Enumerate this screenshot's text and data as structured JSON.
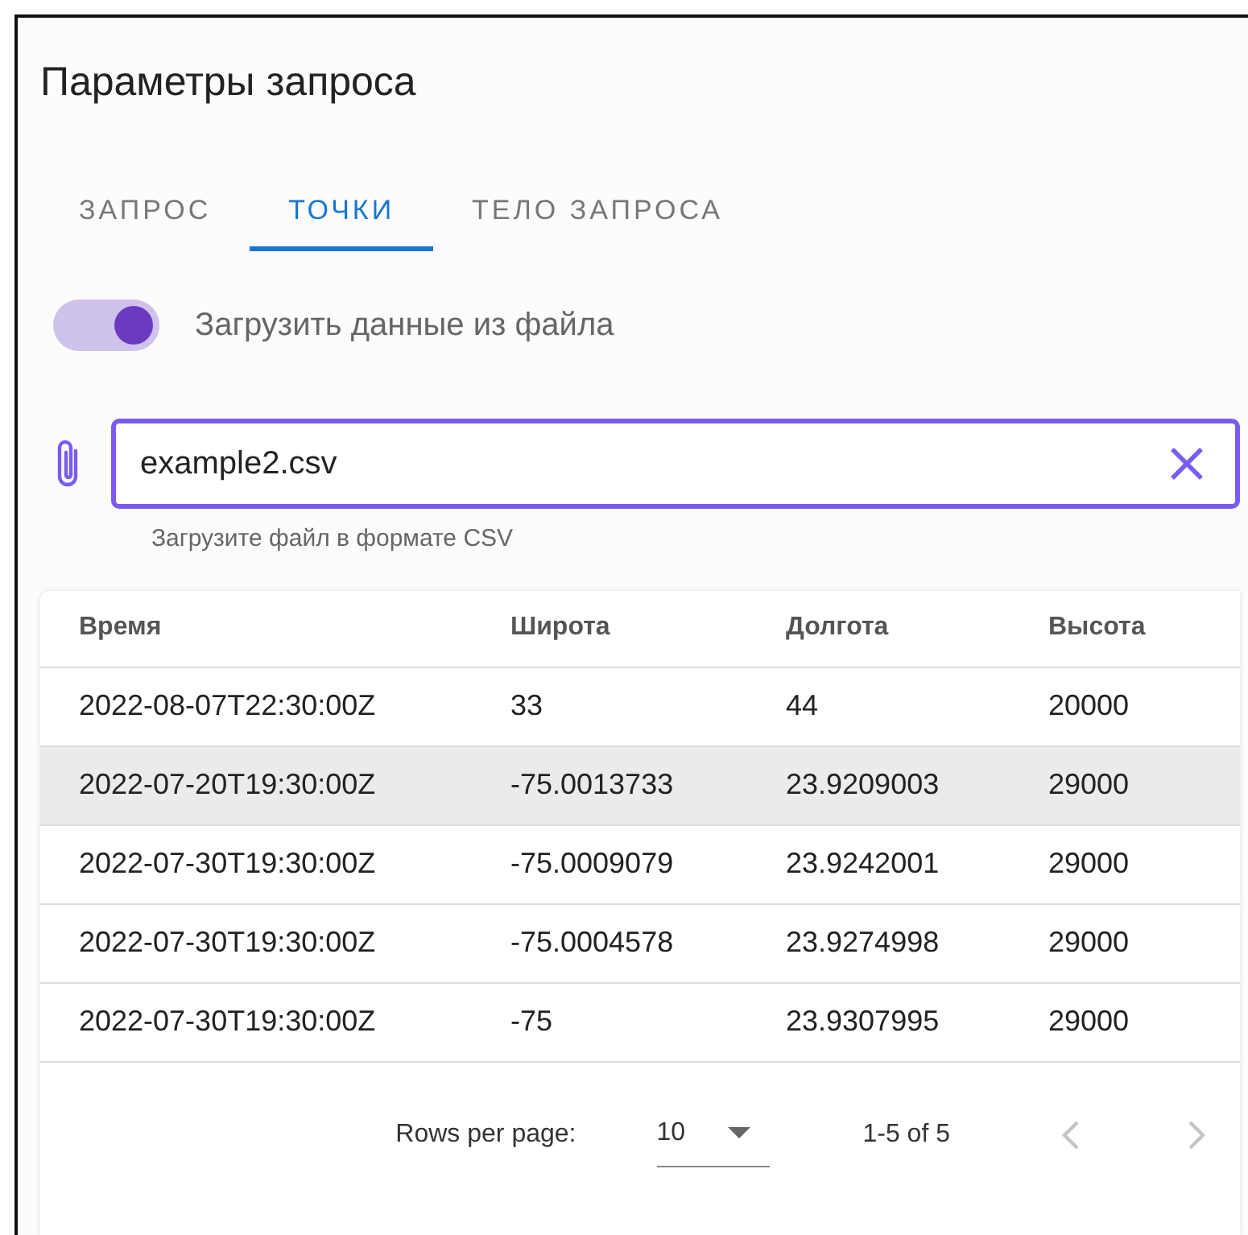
{
  "dialog": {
    "title": "Параметры запроса"
  },
  "tabs": [
    {
      "label": "ЗАПРОС",
      "selected": false
    },
    {
      "label": "ТОЧКИ",
      "selected": true
    },
    {
      "label": "ТЕЛО ЗАПРОСА",
      "selected": false
    }
  ],
  "file_switch": {
    "label": "Загрузить данные из файла",
    "on": true
  },
  "file_field": {
    "value": "example2.csv",
    "helper": "Загрузите файл в формате CSV"
  },
  "table": {
    "columns": [
      "Время",
      "Широта",
      "Долгота",
      "Высота"
    ],
    "rows": [
      {
        "cells": [
          "2022-08-07T22:30:00Z",
          "33",
          "44",
          "20000"
        ],
        "selected": false
      },
      {
        "cells": [
          "2022-07-20T19:30:00Z",
          "-75.0013733",
          "23.9209003",
          "29000"
        ],
        "selected": true
      },
      {
        "cells": [
          "2022-07-30T19:30:00Z",
          "-75.0009079",
          "23.9242001",
          "29000"
        ],
        "selected": false
      },
      {
        "cells": [
          "2022-07-30T19:30:00Z",
          "-75.0004578",
          "23.9274998",
          "29000"
        ],
        "selected": false
      },
      {
        "cells": [
          "2022-07-30T19:30:00Z",
          "-75",
          "23.9307995",
          "29000"
        ],
        "selected": false
      }
    ]
  },
  "pagination": {
    "rows_per_page_label": "Rows per page:",
    "rows_per_page": "10",
    "range": "1-5 of 5",
    "prev_disabled": true,
    "next_disabled": true
  }
}
